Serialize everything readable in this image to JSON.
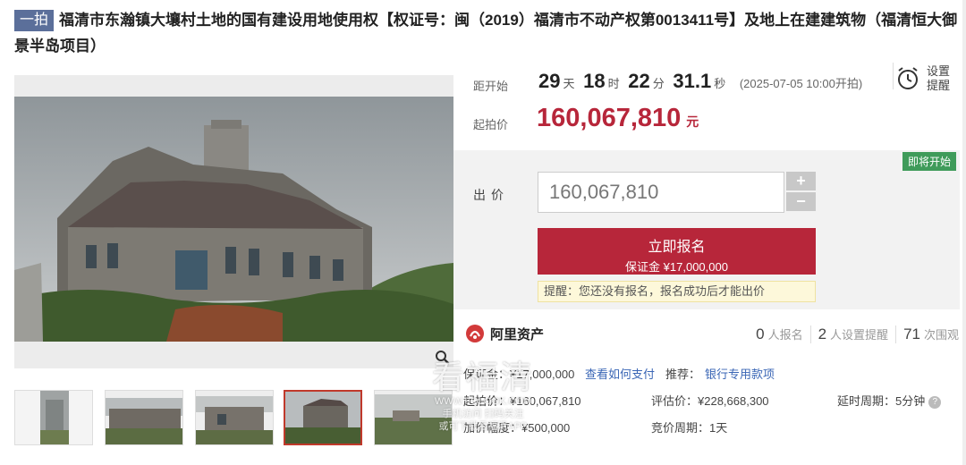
{
  "title": {
    "badge": "一拍",
    "text": "福清市东瀚镇大壤村土地的国有建设用地使用权【权证号：闽（2019）福清市不动产权第0013411号】及地上在建建筑物（福清恒大御景半岛项目）"
  },
  "countdown": {
    "label": "距开始",
    "days": "29",
    "days_unit": "天",
    "hours": "18",
    "hours_unit": "时",
    "minutes": "22",
    "minutes_unit": "分",
    "seconds": "31.1",
    "seconds_unit": "秒",
    "start_time": "(2025-07-05 10:00开拍)"
  },
  "remind": {
    "label": "设置提醒",
    "line1": "设置",
    "line2": "提醒"
  },
  "start_price": {
    "label": "起拍价",
    "value": "160,067,810",
    "unit": "元"
  },
  "status_badge": "即将开始",
  "bid": {
    "label": "出价",
    "value": "160,067,810",
    "plus": "+",
    "minus": "−",
    "signup_label": "立即报名",
    "deposit_text": "保证金 ¥17,000,000",
    "tip": "提醒：您还没有报名，报名成功后才能出价"
  },
  "platform": {
    "name": "阿里资产",
    "signups": "0",
    "signups_label": "人报名",
    "reminders": "2",
    "reminders_label": "人设置提醒",
    "views": "71",
    "views_label": "次围观"
  },
  "details": {
    "deposit": "保证金：¥17,000,000",
    "how_to_pay": "查看如何支付",
    "recommend_label": "推荐：",
    "recommend_link": "银行专用款项",
    "start_price": "起拍价：¥160,067,810",
    "appraisal": "评估价：¥228,668,300",
    "delay": "延时周期：5分钟",
    "increment": "加价幅度：¥500,000",
    "cycle": "竞价周期：1天"
  },
  "watermark": {
    "big": "看福清",
    "url": "WWW.FQLOOK.COM",
    "line1": "手机访问 扫码关注",
    "line2": "或可下载看福清APP"
  },
  "colors": {
    "accent": "#b7263a",
    "green": "#3f9b5a",
    "link": "#3a66b5",
    "badge": "#5b6f9a"
  }
}
